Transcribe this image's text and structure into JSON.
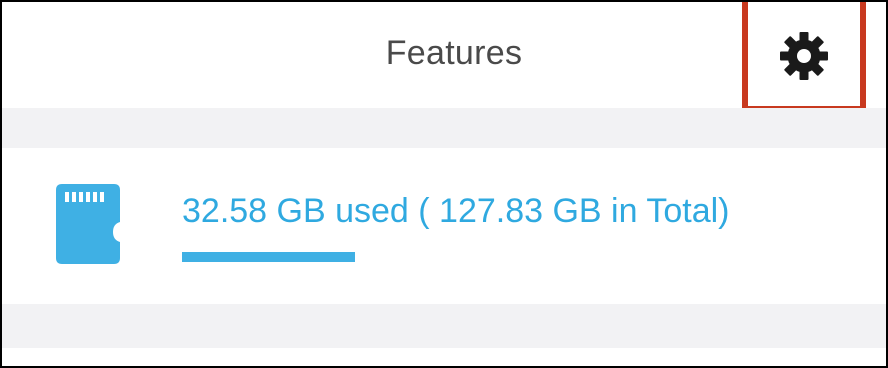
{
  "header": {
    "title": "Features",
    "settings_icon": "gear-icon"
  },
  "storage": {
    "icon": "sd-card-icon",
    "label": "32.58 GB used ( 127.83 GB in Total)",
    "used_gb": 32.58,
    "total_gb": 127.83,
    "used_fraction": 0.2549
  },
  "colors": {
    "accent": "#2fa9e0",
    "highlight_box": "#c8391f",
    "section_gray": "#f2f2f4",
    "title_text": "#4a4a4a"
  }
}
